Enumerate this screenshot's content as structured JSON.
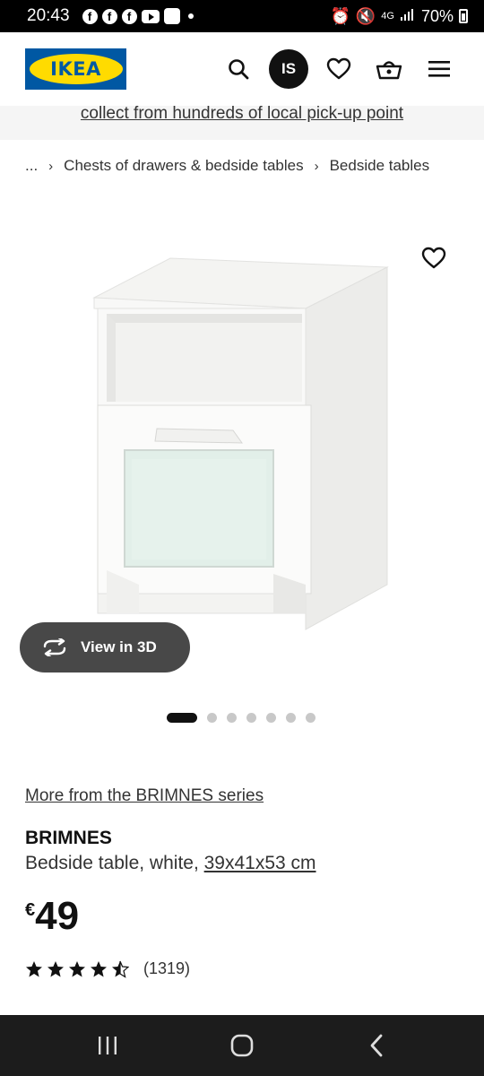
{
  "status_bar": {
    "time": "20:43",
    "network": "4G",
    "battery": "70%"
  },
  "header": {
    "logo_text": "IKEA",
    "avatar_initials": "IS"
  },
  "promo": {
    "text": "collect from hundreds of local pick-up point"
  },
  "breadcrumb": {
    "items": [
      "...",
      "Chests of drawers & bedside tables",
      "Bedside tables"
    ]
  },
  "gallery": {
    "view3d_label": "View in 3D",
    "dot_count": 7,
    "active_index": 0
  },
  "product": {
    "series_link": "More from the BRIMNES series",
    "name": "BRIMNES",
    "description": "Bedside table, white, ",
    "dimensions": "39x41x53 cm",
    "currency": "€",
    "price": "49",
    "rating": 4.5,
    "review_count": "(1319)"
  },
  "colors": {
    "ikea_blue": "#0058a3",
    "ikea_yellow": "#ffdb00",
    "button_dark": "#484848"
  }
}
